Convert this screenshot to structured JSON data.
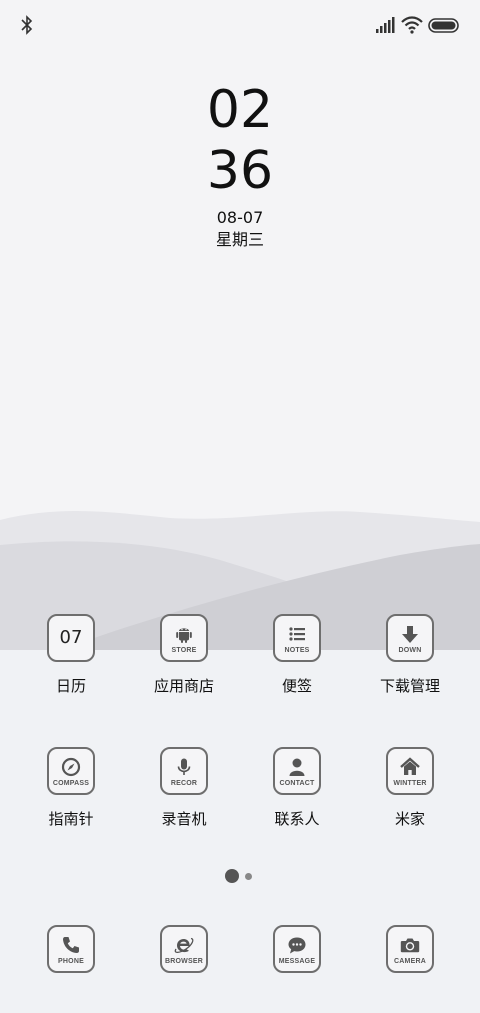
{
  "clock": {
    "hour": "02",
    "minute": "36",
    "date": "08-07",
    "weekday": "星期三"
  },
  "apps_row1": [
    {
      "label": "日历",
      "icon": "calendar-icon",
      "badge": "07"
    },
    {
      "label": "应用商店",
      "icon": "android-icon",
      "caption": "STORE"
    },
    {
      "label": "便签",
      "icon": "list-icon",
      "caption": "NOTES"
    },
    {
      "label": "下载管理",
      "icon": "download-icon",
      "caption": "DOWN"
    }
  ],
  "apps_row2": [
    {
      "label": "指南针",
      "icon": "compass-icon",
      "caption": "COMPASS"
    },
    {
      "label": "录音机",
      "icon": "microphone-icon",
      "caption": "RECOR"
    },
    {
      "label": "联系人",
      "icon": "person-icon",
      "caption": "CONTACT"
    },
    {
      "label": "米家",
      "icon": "home-icon",
      "caption": "WINTTER"
    }
  ],
  "dock": [
    {
      "icon": "phone-icon",
      "caption": "PHONE"
    },
    {
      "icon": "browser-icon",
      "caption": "BROWSER"
    },
    {
      "icon": "message-icon",
      "caption": "MESSAGE"
    },
    {
      "icon": "camera-icon",
      "caption": "CAMERA"
    }
  ],
  "page_indicator": {
    "pages": 2,
    "current": 1
  },
  "colors": {
    "background": "#f2f4f7",
    "icon_stroke": "#6e6e6e",
    "glyph": "#555555"
  }
}
